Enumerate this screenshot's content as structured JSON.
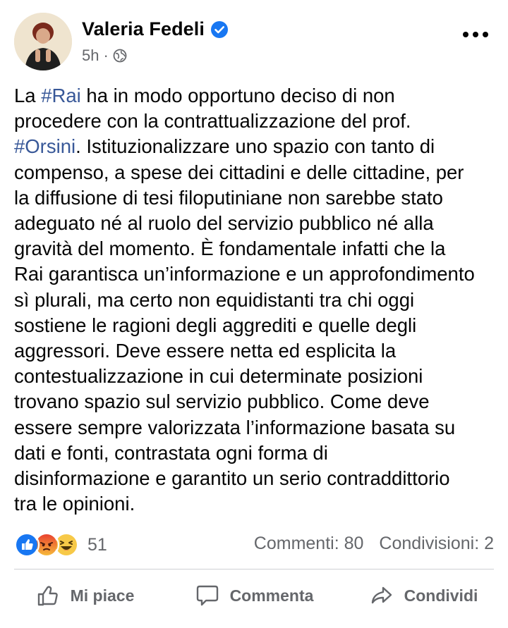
{
  "post": {
    "author": "Valeria Fedeli",
    "time": "5h",
    "dot": "·",
    "text_parts": [
      "La ",
      "#Rai",
      " ha in modo opportuno deciso di non\nprocedere con la contrattualizzazione del prof.\n",
      "#Orsini",
      ". Istituzionalizzare uno spazio con tanto di\ncompenso, a spese dei cittadini e delle cittadine, per\nla diffusione di tesi filoputiniane non sarebbe stato\nadeguato né al ruolo del servizio pubblico né alla\ngravità del momento. È fondamentale infatti che la\nRai garantisca un’informazione e un approfondimento\nsì plurali, ma certo non equidistanti tra chi oggi\nsostiene le ragioni degli aggrediti e quelle degli\naggressori. Deve essere netta ed esplicita la\ncontestualizzazione in cui determinate posizioni\ntrovano spazio sul servizio pubblico. Come deve\nessere sempre valorizzata l’informazione basata su\ndati e fonti, contrastata ogni forma di\ndisinformazione e garantito un serio contraddittorio\ntra le opinioni."
    ]
  },
  "stats": {
    "reaction_icons": [
      "like-icon",
      "angry-icon",
      "haha-icon"
    ],
    "reaction_count": "51",
    "comments": "Commenti: 80",
    "shares": "Condivisioni: 2"
  },
  "actions": {
    "like": "Mi piace",
    "comment": "Commenta",
    "share": "Condividi"
  },
  "colors": {
    "hashtag": "#385898",
    "verified": "#1877f2",
    "secondary_text": "#65676b"
  }
}
